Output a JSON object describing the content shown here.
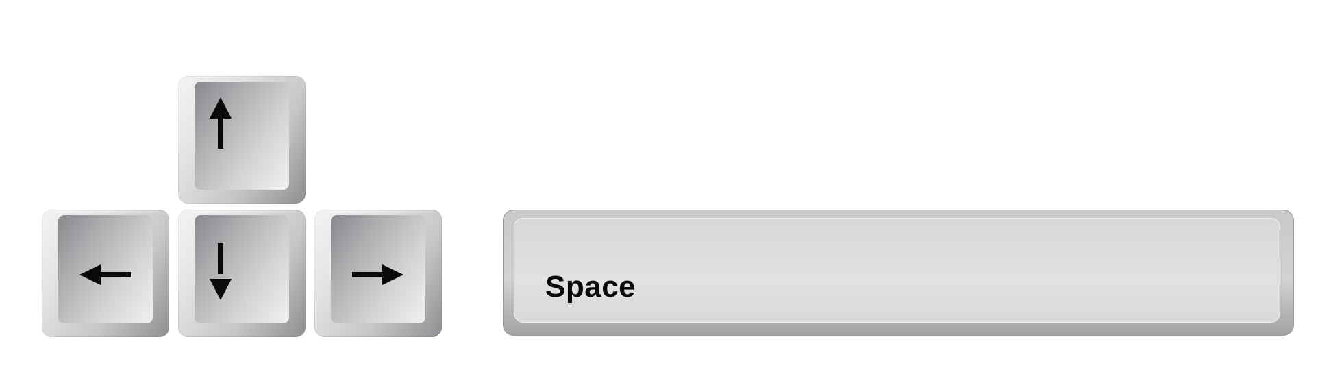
{
  "keys": {
    "up": {
      "icon": "arrow-up-icon"
    },
    "left": {
      "icon": "arrow-left-icon"
    },
    "down": {
      "icon": "arrow-down-icon"
    },
    "right": {
      "icon": "arrow-right-icon"
    },
    "space": {
      "label": "Space"
    }
  },
  "colors": {
    "background": "#ffffff",
    "key_light": "#f4f4f4",
    "key_dark": "#8f8f93",
    "space_face": "#e1e1e1",
    "glyph": "#0a0a0a"
  }
}
